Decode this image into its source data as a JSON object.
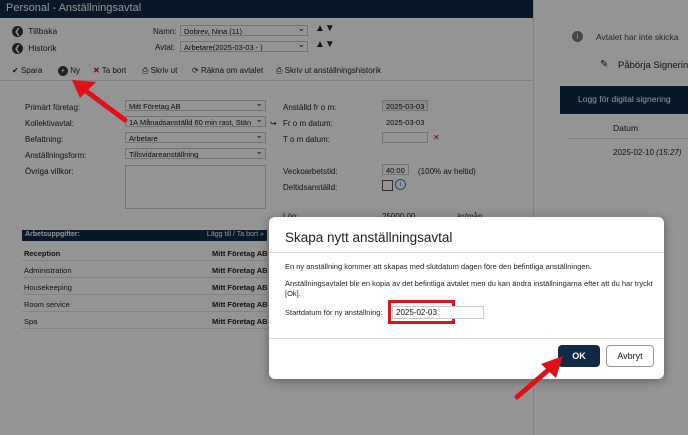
{
  "window": {
    "title": "Personal - Anställningsavtal"
  },
  "nav": {
    "back": "Tillbaka",
    "history": "Historik"
  },
  "header": {
    "name_label": "Namn:",
    "name_value": "Dobrev, Nina (11)",
    "agreement_label": "Avtal:",
    "agreement_value": "Arbetare(2025-03-03 - )"
  },
  "toolbar": {
    "save": "Spara",
    "new": "Ny",
    "delete": "Ta bort",
    "print": "Skriv ut",
    "recalc": "Räkna om avtalet",
    "print_history": "Skriv ut anställningshistorik"
  },
  "form": {
    "company_label": "Primärt företag:",
    "company_value": "Mitt Företag AB",
    "collective_label": "Kollektivavtal:",
    "collective_value": "1A Månadsanställd 60 min rast, Stän",
    "position_label": "Befattning:",
    "position_value": "Arbetare",
    "employment_form_label": "Anställningsform:",
    "employment_form_value": "Tillsvidareanställning",
    "other_terms_label": "Övriga villkor:",
    "employed_from_label": "Anställd fr o m:",
    "employed_from_value": "2025-03-03",
    "from_date_label": "Fr o m datum:",
    "from_date_value": "2025-03-03",
    "to_date_label": "T o m datum:",
    "weekly_hours_label": "Veckoarbetstid:",
    "weekly_hours_value": "40:00",
    "weekly_hours_note": "(100% av heltid)",
    "part_time_label": "Deltidsanställd:",
    "salary_label": "Lön:",
    "salary_value": "25000.00",
    "salary_unit": "kr/mån"
  },
  "tasks": {
    "header": "Arbetsuppgifter:",
    "header_action": "Lägg till / Ta bort »",
    "rows": [
      {
        "name": "Reception",
        "company": "Mitt Företag AB",
        "bold": true
      },
      {
        "name": "Administration",
        "company": "Mitt Företag AB"
      },
      {
        "name": "Housekeeping",
        "company": "Mitt Företag AB"
      },
      {
        "name": "Room service",
        "company": "Mitt Företag AB"
      },
      {
        "name": "Spa",
        "company": "Mitt Företag AB"
      }
    ]
  },
  "right_panel": {
    "notice": "Avtalet har inte skicka",
    "start_signing": "Påbörja Signering",
    "log_header": "Logg för digital signering",
    "date_col": "Datum",
    "log_date": "2025-02-10",
    "log_time": "(15:27)"
  },
  "dialog": {
    "title": "Skapa nytt anställningsavtal",
    "text1": "En ny anställning kommer att skapas med slutdatum dagen före den befintliga anställningen.",
    "text2": "Anställningsavtalet blir en kopia av det befintliga avtalet men du kan ändra inställningarna efter att du har tryckt [Ok].",
    "start_label": "Startdatum för ny anställning:",
    "start_value": "2025-02-03",
    "ok": "OK",
    "cancel": "Avbryt"
  },
  "colors": {
    "navy": "#0e2a47",
    "highlight": "#e0101a",
    "overlay": "rgba(0,0,0,0.42)"
  }
}
